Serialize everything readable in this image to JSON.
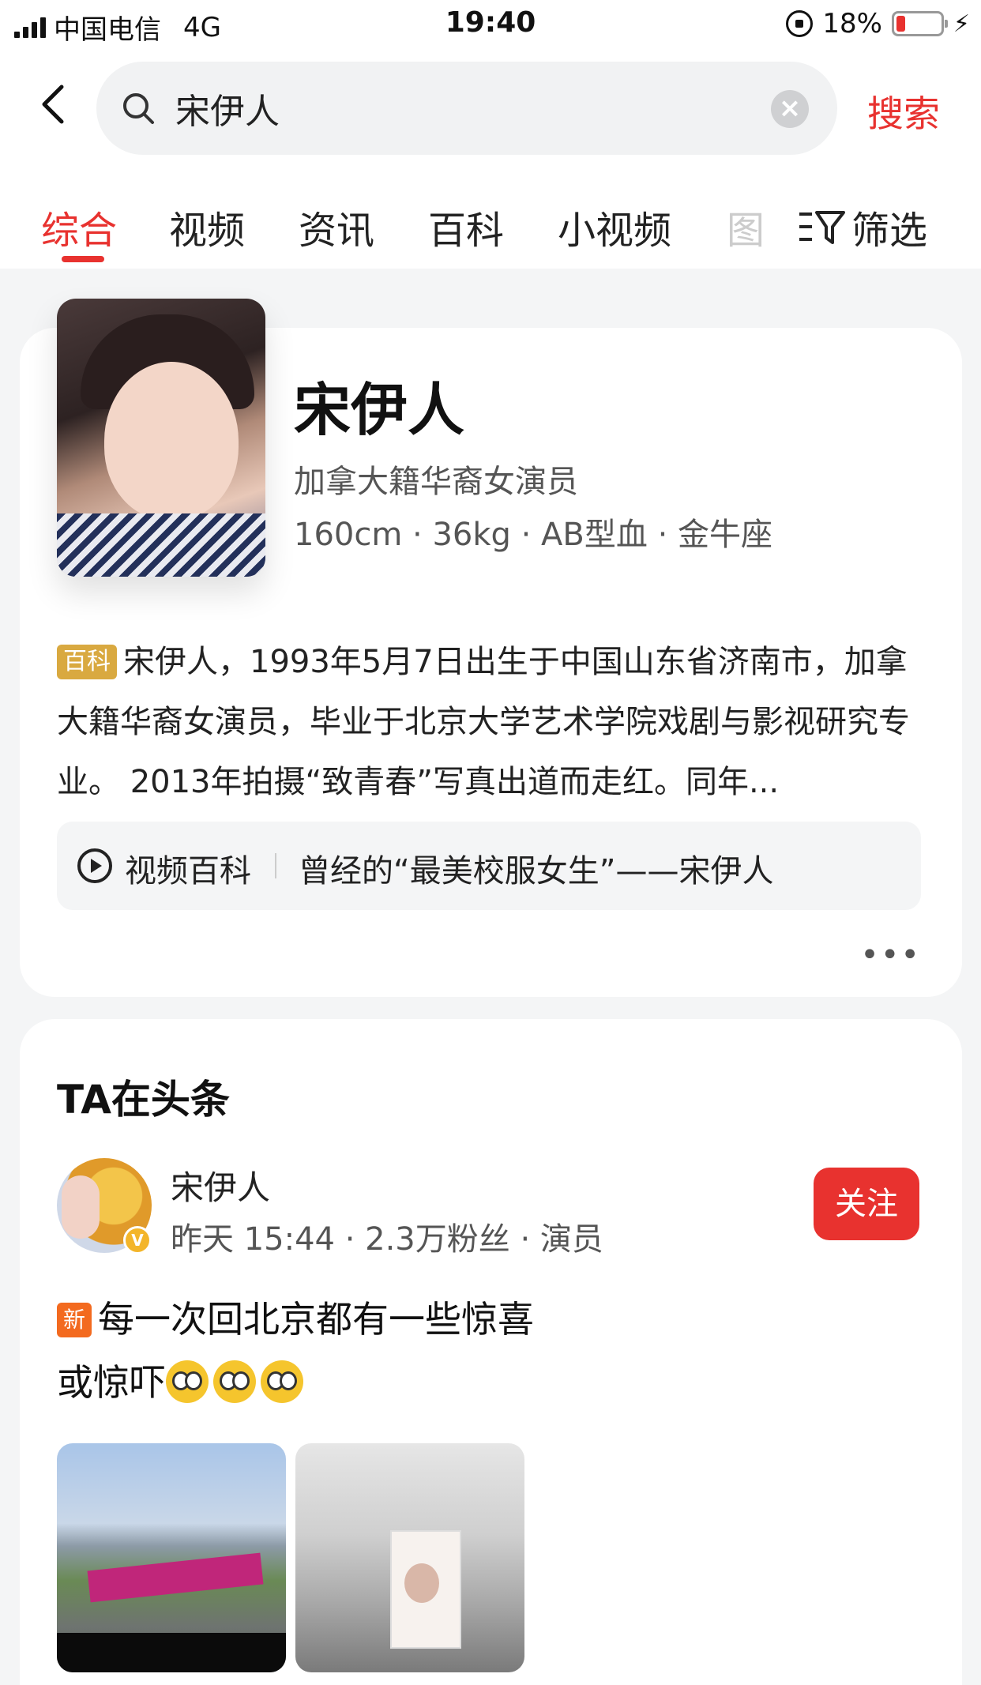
{
  "status_bar": {
    "carrier": "中国电信",
    "network": "4G",
    "time": "19:40",
    "battery": "18%",
    "battery_level": 0.18
  },
  "search": {
    "query": "宋伊人",
    "button": "搜索"
  },
  "tabs": [
    {
      "label": "综合",
      "active": true
    },
    {
      "label": "视频"
    },
    {
      "label": "资讯"
    },
    {
      "label": "百科"
    },
    {
      "label": "小视频"
    }
  ],
  "tab_partial": "图",
  "filter_label": "筛选",
  "profile": {
    "name": "宋伊人",
    "description": "加拿大籍华裔女演员",
    "stats": "160cm · 36kg · AB型血 · 金牛座",
    "bio_badge": "百科",
    "bio": "宋伊人，1993年5月7日出生于中国山东省济南市，加拿大籍华裔女演员，毕业于北京大学艺术学院戏剧与影视研究专业。 2013年拍摄“致青春”写真出道而走红。同年...",
    "video_baike_label": "视频百科",
    "video_baike_title": "曾经的“最美校服女生”——宋伊人",
    "more": "•••"
  },
  "toutiao": {
    "section_title": "TA在头条",
    "author_name": "宋伊人",
    "author_meta": "昨天 15:44 · 2.3万粉丝 · 演员",
    "follow": "关注",
    "new_badge": "新",
    "post_line1": "每一次回北京都有一些惊喜",
    "post_line2": "或惊吓"
  },
  "colors": {
    "accent": "#e8322f",
    "baike_badge": "#d9a940",
    "new_badge": "#f36a1f"
  }
}
